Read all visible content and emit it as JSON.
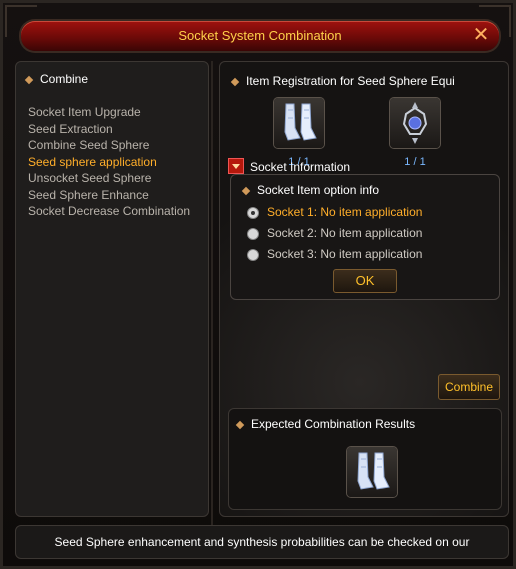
{
  "window": {
    "title": "Socket System Combination",
    "close_icon": "close-x-icon"
  },
  "sidebar": {
    "header": "Combine",
    "items": [
      {
        "label": "Socket Item Upgrade",
        "active": false
      },
      {
        "label": "Seed Extraction",
        "active": false
      },
      {
        "label": "Combine Seed Sphere",
        "active": false
      },
      {
        "label": "Seed sphere application",
        "active": true
      },
      {
        "label": "Unsocket Seed Sphere",
        "active": false
      },
      {
        "label": "Seed Sphere Enhance",
        "active": false
      },
      {
        "label": "Socket Decrease Combination",
        "active": false
      }
    ]
  },
  "registration": {
    "title": "Item Registration for Seed Sphere Equi",
    "slots": [
      {
        "icon": "boots-icon",
        "count": "1 / 1"
      },
      {
        "icon": "seed-sphere-icon",
        "count": "1 / 1"
      }
    ]
  },
  "socket_info": {
    "title": "Socket Information",
    "option_title": "Socket Item option info",
    "options": [
      {
        "label": "Socket 1: No item application",
        "selected": true
      },
      {
        "label": "Socket 2: No item application",
        "selected": false
      },
      {
        "label": "Socket 3: No item application",
        "selected": false
      }
    ],
    "ok_label": "OK"
  },
  "combine_label": "Combine",
  "results": {
    "title": "Expected Combination Results",
    "icon": "boots-icon"
  },
  "footer": {
    "text": "Seed Sphere enhancement and synthesis probabilities can be checked on our"
  },
  "colors": {
    "accent": "#ffae2a",
    "title_bar": "#8a100c",
    "count": "#7ab8ff"
  }
}
